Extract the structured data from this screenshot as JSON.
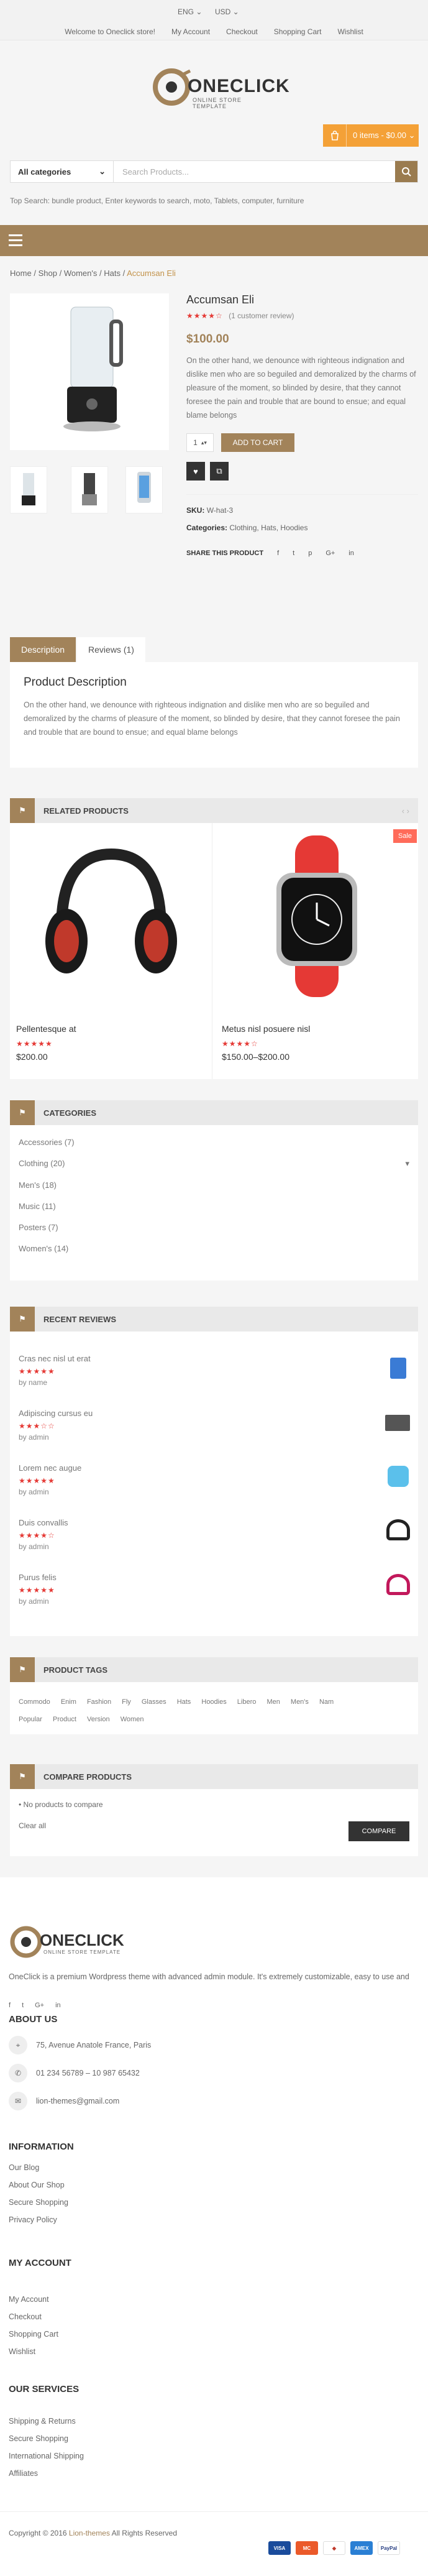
{
  "topbar": {
    "language": "ENG ⌄",
    "currency": "USD ⌄",
    "links": [
      "Welcome to Oneclick store!",
      "My Account",
      "Checkout",
      "Shopping Cart",
      "Wishlist"
    ]
  },
  "logo": {
    "name": "ONECLICK",
    "tagline": "ONLINE STORE TEMPLATE"
  },
  "cart": {
    "label": "0 items - $0.00 ⌄"
  },
  "search": {
    "category": "All categories",
    "placeholder": "Search Products...",
    "top_search": "Top Search: bundle product, Enter keywords to search, moto, Tablets, computer, furniture"
  },
  "breadcrumb": {
    "home": "Home",
    "shop": "Shop",
    "womens": "Women's",
    "hats": "Hats",
    "current": "Accumsan Eli",
    "sep": "/"
  },
  "product": {
    "title": "Accumsan Eli",
    "rating_stars": "★★★★☆",
    "reviews": "(1 customer review)",
    "price": "$100.00",
    "description": "On the other hand, we denounce with righteous indignation and dislike men who are so beguiled and demoralized by the charms of pleasure of the moment, so blinded by desire, that they cannot foresee the pain and trouble that are bound to ensue; and equal blame belongs",
    "qty": "1",
    "add_to_cart": "ADD TO CART",
    "sku_label": "SKU:",
    "sku": "W-hat-3",
    "categories_label": "Categories:",
    "categories": "Clothing, Hats, Hoodies",
    "share_label": "SHARE THIS PRODUCT"
  },
  "tabs": {
    "description": "Description",
    "reviews": "Reviews (1)"
  },
  "desc_box": {
    "title": "Product Description",
    "text": "On the other hand, we denounce with righteous indignation and dislike men who are so beguiled and demoralized by the charms of pleasure of the moment, so blinded by desire, that they cannot foresee the pain and trouble that are bound to ensue; and equal blame belongs"
  },
  "related": {
    "title": "RELATED PRODUCTS",
    "items": [
      {
        "name": "Pellentesque at",
        "stars": "★★★★★",
        "price": "$200.00"
      },
      {
        "name": "Metus nisl posuere nisl",
        "stars": "★★★★☆",
        "price": "$150.00–$200.00",
        "badge": "Sale"
      }
    ]
  },
  "categories_widget": {
    "title": "CATEGORIES",
    "items": [
      "Accessories (7)",
      "Clothing (20)",
      "Men's (18)",
      "Music (11)",
      "Posters (7)",
      "Women's (14)"
    ]
  },
  "reviews_widget": {
    "title": "RECENT REVIEWS",
    "items": [
      {
        "name": "Cras nec nisl ut erat",
        "stars": "★★★★★",
        "by": "by name"
      },
      {
        "name": "Adipiscing cursus eu",
        "stars": "★★★☆☆",
        "by": "by admin"
      },
      {
        "name": "Lorem nec augue",
        "stars": "★★★★★",
        "by": "by admin"
      },
      {
        "name": "Duis convallis",
        "stars": "★★★★☆",
        "by": "by admin"
      },
      {
        "name": "Purus felis",
        "stars": "★★★★★",
        "by": "by admin"
      }
    ]
  },
  "tags_widget": {
    "title": "PRODUCT TAGS",
    "tags": [
      "Commodo",
      "Enim",
      "Fashion",
      "Fly",
      "Glasses",
      "Hats",
      "Hoodies",
      "Libero",
      "Men",
      "Men's",
      "Nam",
      "Popular",
      "Product",
      "Version",
      "Women"
    ]
  },
  "compare_widget": {
    "title": "COMPARE PRODUCTS",
    "empty": "No products to compare",
    "clear": "Clear all",
    "button": "COMPARE"
  },
  "footer": {
    "about": "OneClick is a premium Wordpress theme with advanced admin module. It's extremely customizable, easy to use and",
    "about_title": "ABOUT US",
    "address": "75, Avenue Anatole France, Paris",
    "phone": "01 234 56789 – 10 987 65432",
    "email": "lion-themes@gmail.com",
    "info_title": "INFORMATION",
    "info_links": [
      "Our Blog",
      "About Our Shop",
      "Secure Shopping",
      "Privacy Policy"
    ],
    "account_title": "MY ACCOUNT",
    "account_links": [
      "My Account",
      "Checkout",
      "Shopping Cart",
      "Wishlist"
    ],
    "services_title": "OUR SERVICES",
    "services_links": [
      "Shipping & Returns",
      "Secure Shopping",
      "International Shipping",
      "Affiliates"
    ],
    "copyright": "Copyright © 2016 ",
    "copyright_brand": "Lion-themes",
    "copyright_tail": " All Rights Reserved",
    "payments": [
      "VISA",
      "MC",
      "AMEX",
      "PayPal"
    ]
  },
  "colors": {
    "accent": "#a2835a",
    "cart": "#f4a137",
    "star": "#e53935",
    "sale": "#ff6b5a"
  }
}
